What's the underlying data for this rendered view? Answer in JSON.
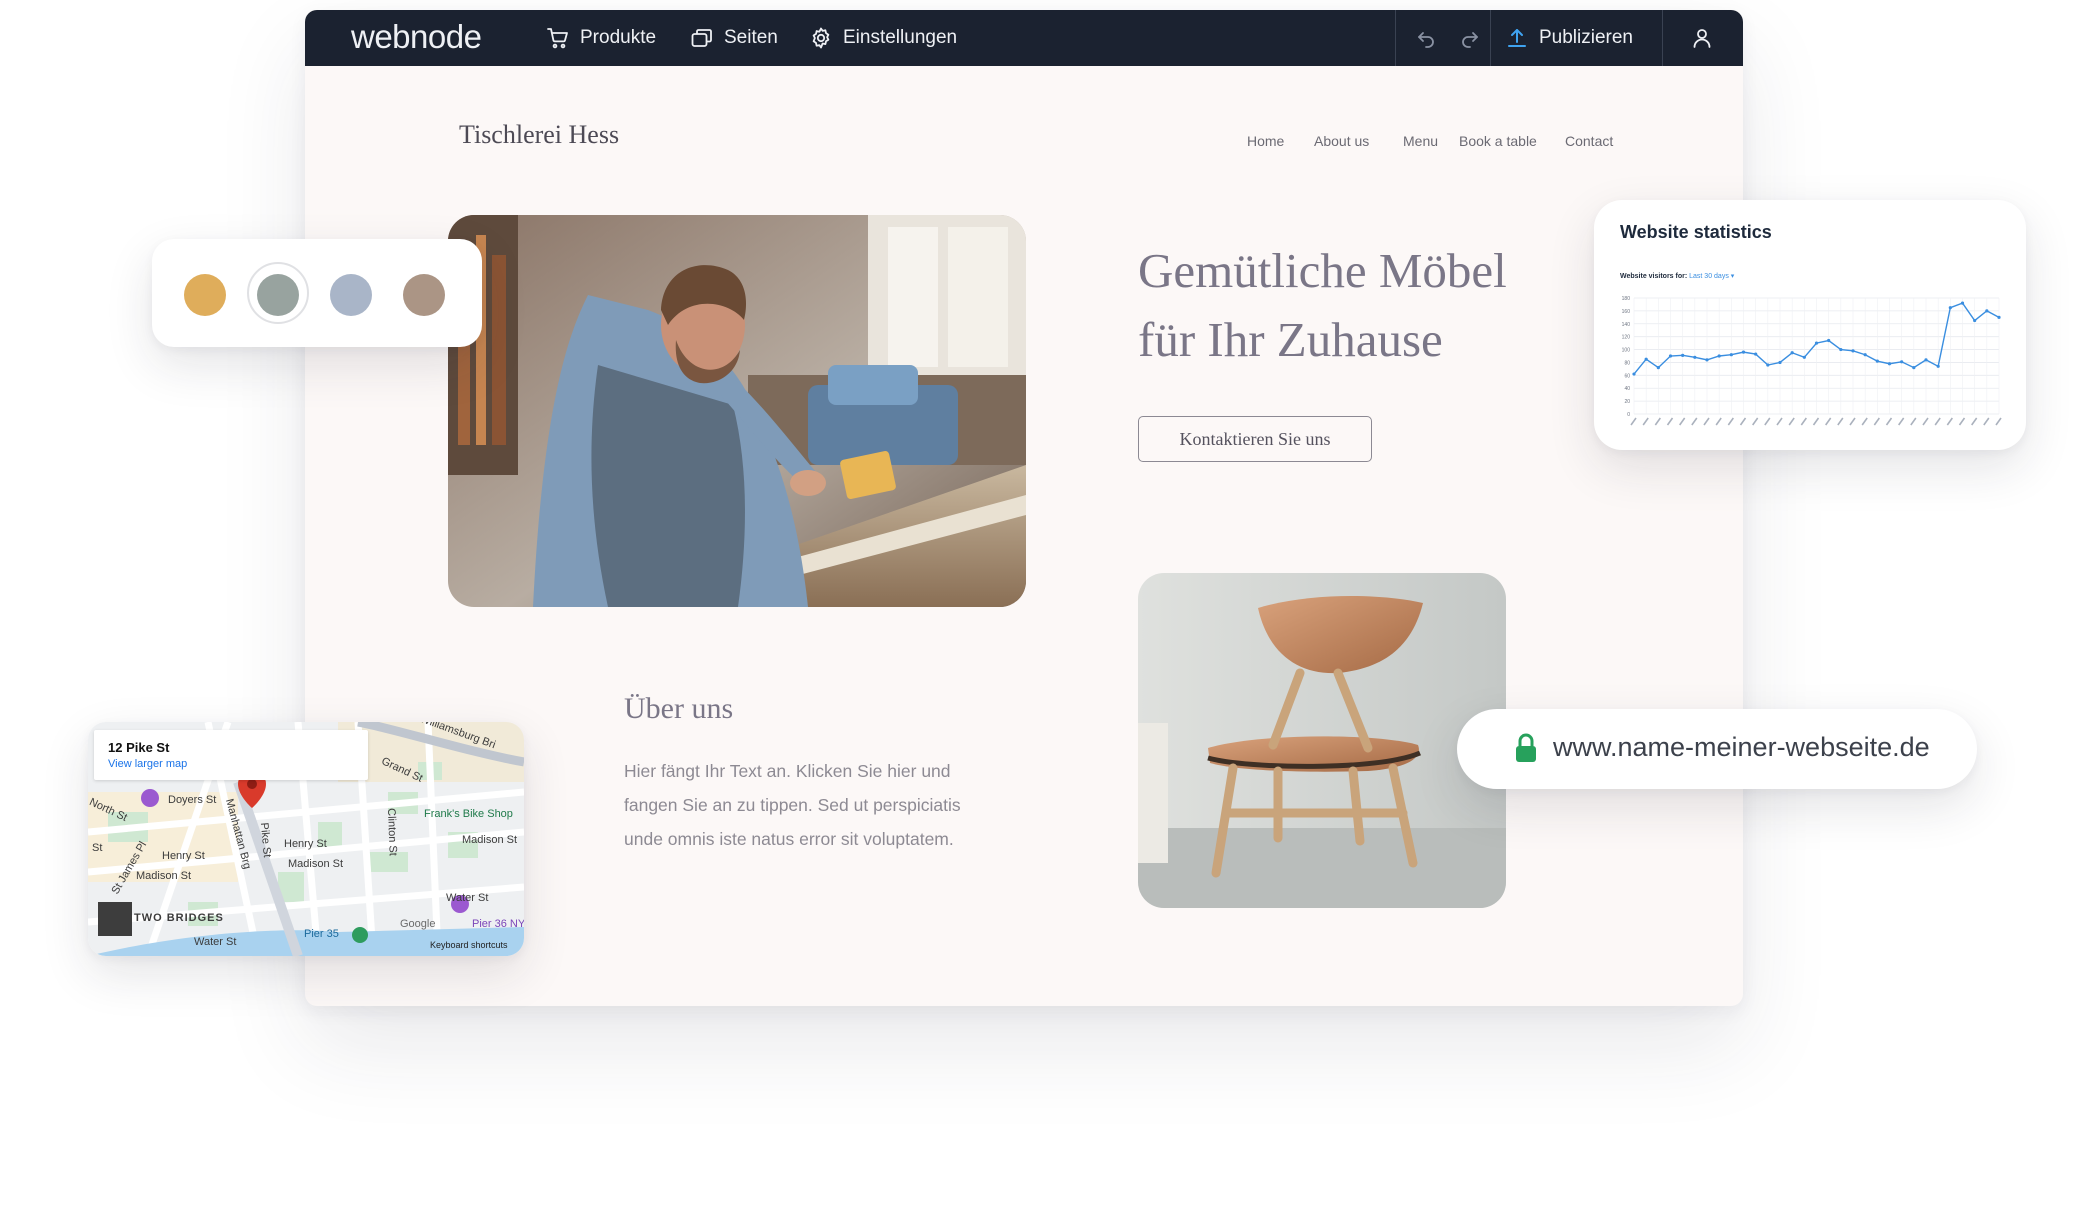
{
  "editor": {
    "logo": "webnode",
    "menu": {
      "products": "Produkte",
      "pages": "Seiten",
      "settings": "Einstellungen"
    },
    "publish": "Publizieren"
  },
  "site": {
    "title": "Tischlerei Hess",
    "nav": [
      "Home",
      "About us",
      "Menu",
      "Book a table",
      "Contact"
    ],
    "headline_line1": "Gemütliche Möbel",
    "headline_line2": "für Ihr Zuhause",
    "cta": "Kontaktieren Sie uns",
    "about_title": "Über uns",
    "about_text": "Hier fängt Ihr Text an. Klicken Sie hier und fangen Sie an zu tippen. Sed ut perspiciatis unde omnis iste natus error sit voluptatem."
  },
  "swatches": {
    "colors": [
      "#dfad5b",
      "#98a39f",
      "#a9b5c8",
      "#ab9585"
    ],
    "selected_index": 1
  },
  "stats": {
    "title": "Website statistics",
    "subtitle_prefix": "Website visitors for:",
    "subtitle_period": "Last 30 days ▾",
    "accent": "#3a8ee0"
  },
  "chart_data": {
    "type": "line",
    "title": "Website statistics",
    "ylim": [
      0,
      180
    ],
    "yticks": [
      0,
      20,
      40,
      60,
      80,
      100,
      120,
      140,
      160,
      180
    ],
    "grid": true,
    "series": [
      {
        "values": [
          62,
          85,
          72,
          90,
          91,
          88,
          84,
          90,
          92,
          96,
          93,
          76,
          80,
          95,
          88,
          110,
          114,
          100,
          98,
          92,
          82,
          78,
          81,
          72,
          84,
          74,
          165,
          172,
          145,
          160,
          150
        ]
      }
    ]
  },
  "url": {
    "text": "www.name-meiner-webseite.de",
    "lock_color": "#27a15c"
  },
  "map": {
    "address": "12 Pike St",
    "link": "View larger map",
    "labels": {
      "williamsburg": "Williamsburg Bri",
      "grand": "Grand St",
      "doyers": "Doyers St",
      "north": "North St",
      "franks": "Frank's Bike Shop",
      "st": "St",
      "henry1": "Henry St",
      "henry2": "Henry St",
      "madison1": "Madison St",
      "madison2": "Madison St",
      "madison3": "Madison St",
      "james": "St James Pl",
      "manhattan": "Manhattan Brg",
      "pike": "Pike St",
      "clinton": "Clinton St",
      "water1": "Water St",
      "water2": "Water St",
      "two_bridges": "TWO BRIDGES",
      "pier35": "Pier 35",
      "pier36": "Pier 36 NY",
      "google": "Google",
      "shortcuts": "Keyboard shortcuts"
    }
  }
}
